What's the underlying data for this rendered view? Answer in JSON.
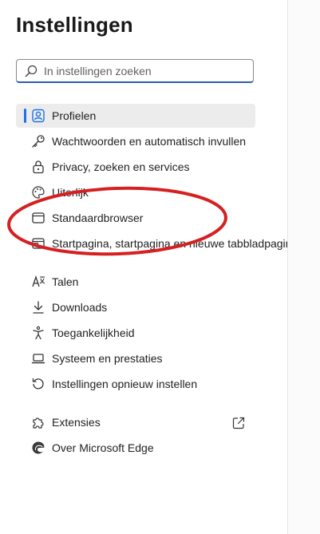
{
  "header": {
    "title": "Instellingen"
  },
  "search": {
    "placeholder": "In instellingen zoeken"
  },
  "nav": {
    "group1": [
      {
        "label": "Profielen",
        "icon": "profile-icon",
        "active": true
      },
      {
        "label": "Wachtwoorden en automatisch invullen",
        "icon": "key-icon"
      },
      {
        "label": "Privacy, zoeken en services",
        "icon": "lock-icon"
      },
      {
        "label": "Uiterlijk",
        "icon": "palette-icon"
      },
      {
        "label": "Standaardbrowser",
        "icon": "browser-icon"
      },
      {
        "label": "Startpagina, startpagina en nieuwe tabbladpagina",
        "icon": "start-page-icon"
      }
    ],
    "group2": [
      {
        "label": "Talen",
        "icon": "languages-icon"
      },
      {
        "label": "Downloads",
        "icon": "download-icon"
      },
      {
        "label": "Toegankelijkheid",
        "icon": "accessibility-icon"
      },
      {
        "label": "Systeem en prestaties",
        "icon": "laptop-icon"
      },
      {
        "label": "Instellingen opnieuw instellen",
        "icon": "reset-icon"
      }
    ],
    "group3": [
      {
        "label": "Extensies",
        "icon": "puzzle-icon",
        "external": true
      },
      {
        "label": "Over Microsoft Edge",
        "icon": "edge-logo-icon"
      }
    ]
  },
  "colors": {
    "accent": "#1a73e8",
    "annotation": "#d62020",
    "active_bg": "#ececec"
  }
}
